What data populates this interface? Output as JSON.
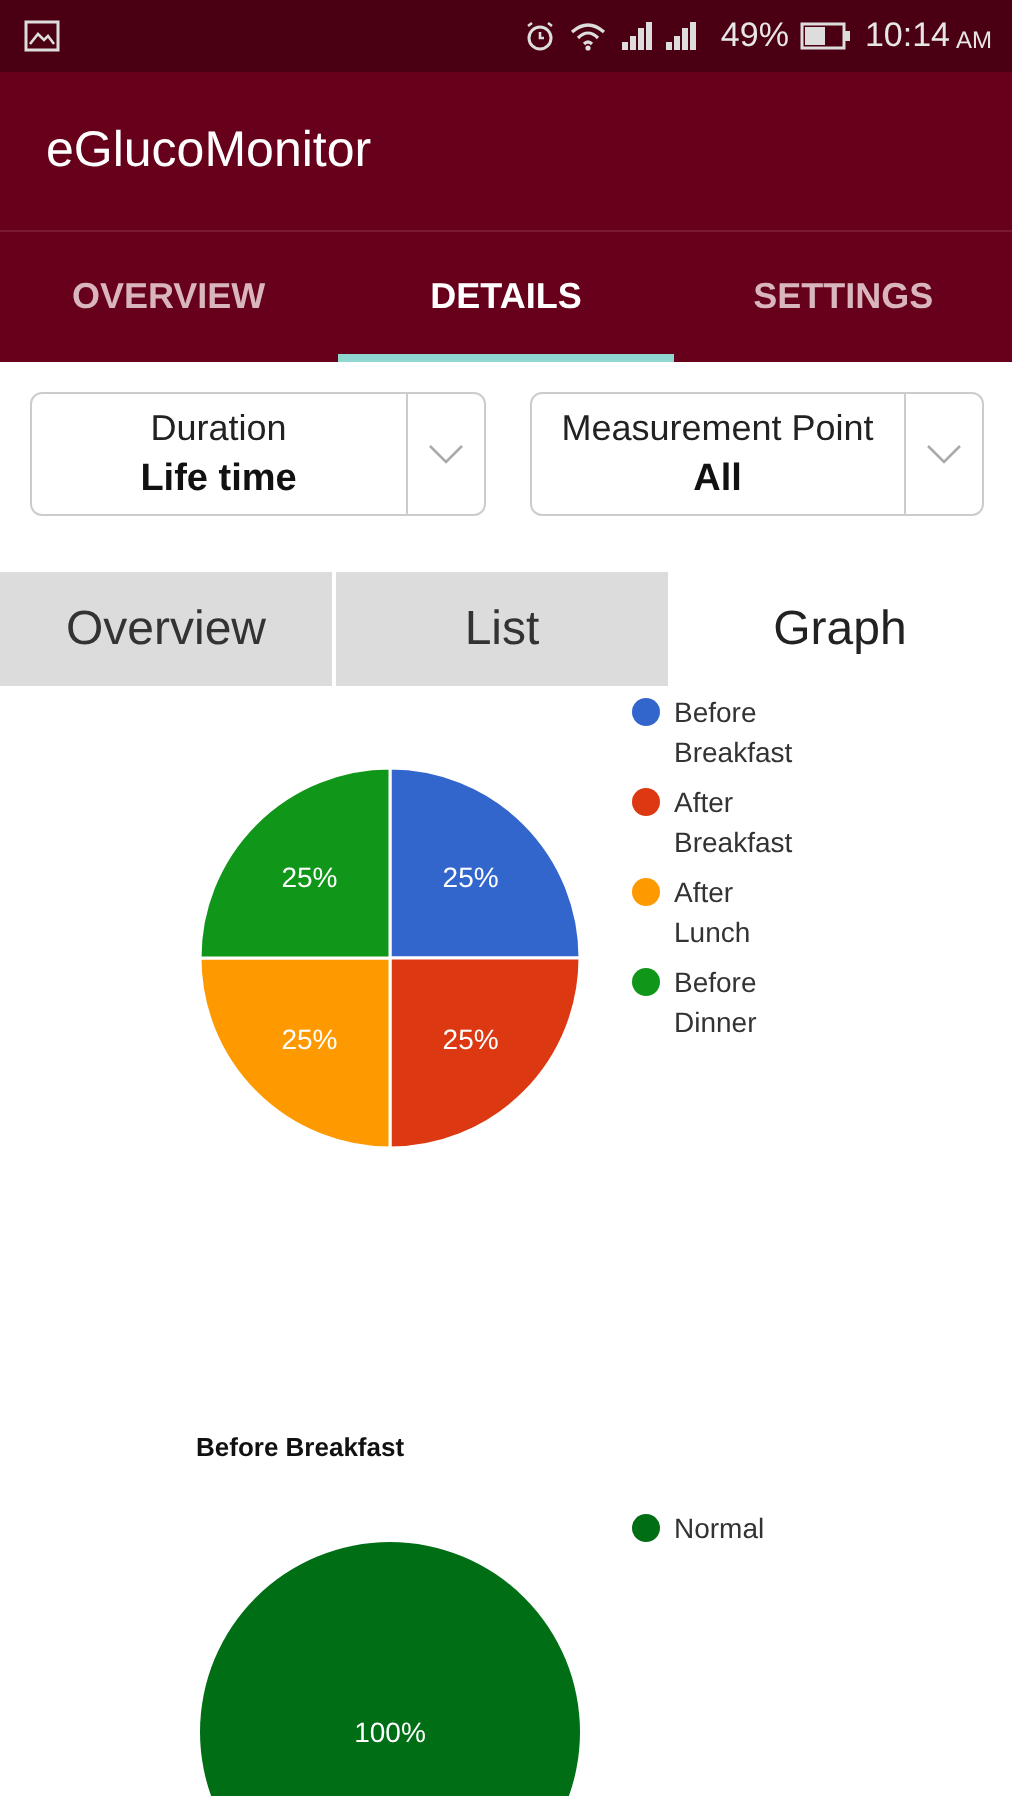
{
  "status_bar": {
    "battery": "49%",
    "time": "10:14",
    "ampm": "AM"
  },
  "app_bar": {
    "title": "eGlucoMonitor"
  },
  "tabs": [
    {
      "label": "OVERVIEW",
      "selected": false
    },
    {
      "label": "DETAILS",
      "selected": true
    },
    {
      "label": "SETTINGS",
      "selected": false
    }
  ],
  "filters": [
    {
      "label": "Duration",
      "value": "Life time"
    },
    {
      "label": "Measurement Point",
      "value": "All"
    }
  ],
  "view_tabs": [
    {
      "label": "Overview",
      "selected": false
    },
    {
      "label": "List",
      "selected": false
    },
    {
      "label": "Graph",
      "selected": true
    }
  ],
  "charts": [
    {
      "chart_data": {
        "type": "pie",
        "legend": "right",
        "data_labels": true,
        "categories": [
          "Before Breakfast",
          "After Breakfast",
          "After Lunch",
          "Before Dinner"
        ],
        "values": [
          25,
          25,
          25,
          25
        ],
        "value_labels": [
          "25%",
          "25%",
          "25%",
          "25%"
        ],
        "colors": [
          "#3366cc",
          "#dc3912",
          "#ff9900",
          "#109618"
        ]
      }
    },
    {
      "chart_data": {
        "type": "pie",
        "title": "Before Breakfast",
        "legend": "right",
        "data_labels": true,
        "categories": [
          "Normal"
        ],
        "values": [
          100
        ],
        "value_labels": [
          "100%"
        ],
        "colors": [
          "#006e15"
        ]
      }
    }
  ]
}
